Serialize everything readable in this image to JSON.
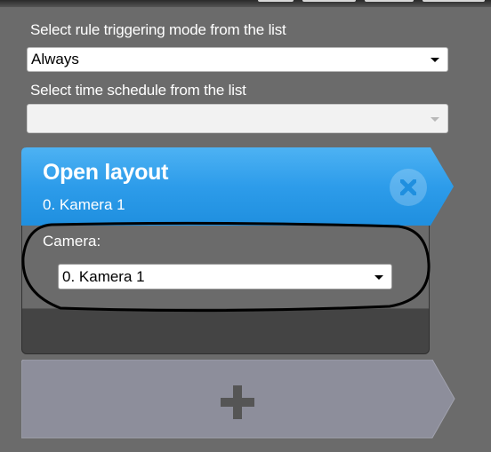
{
  "trigger_mode": {
    "label": "Select rule triggering mode from the list",
    "value": "Always"
  },
  "schedule": {
    "label": "Select time schedule from the list",
    "value": ""
  },
  "action_card": {
    "title": "Open layout",
    "subtitle": "0. Kamera 1",
    "camera_label": "Camera:",
    "camera_value": "0. Kamera 1"
  },
  "colors": {
    "header_blue": "#2f9de8",
    "background": "#6b6b6b",
    "add_button": "#8d8e9b"
  },
  "icons": {
    "close": "close-icon",
    "add": "plus-icon",
    "dropdown": "chevron-down-icon"
  }
}
